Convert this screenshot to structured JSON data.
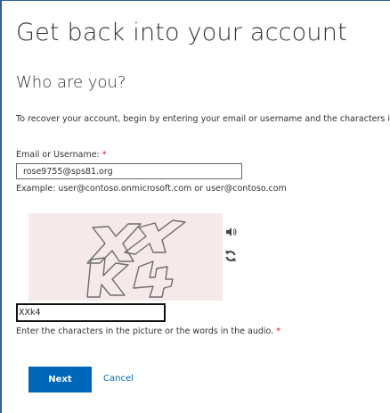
{
  "page": {
    "title": "Get back into your account",
    "subtitle": "Who are you?",
    "description": "To recover your account, begin by entering your email or username and the characters in the picture or audio below."
  },
  "email": {
    "label": "Email or Username: ",
    "required_marker": "*",
    "value": "rose9755@sps81.org",
    "hint": "Example: user@contoso.onmicrosoft.com or user@contoso.com"
  },
  "captcha": {
    "image_text": "XXk4",
    "audio_icon": "speaker-icon",
    "refresh_icon": "refresh-icon",
    "input_value": "XXk4",
    "hint": "Enter the characters in the picture or the words in the audio. ",
    "required_marker": "*"
  },
  "actions": {
    "next_label": "Next",
    "cancel_label": "Cancel"
  },
  "colors": {
    "accent": "#0067b8",
    "required": "#e81123",
    "captcha_bg": "#f6e9e9",
    "frame": "#2f5f9f"
  }
}
